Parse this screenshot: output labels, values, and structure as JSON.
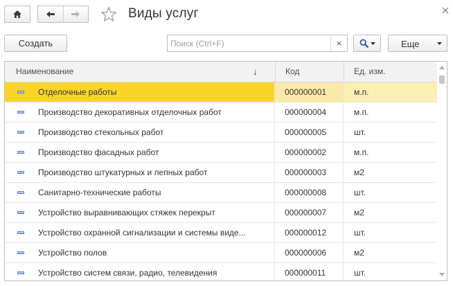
{
  "window": {
    "title": "Виды услуг",
    "icons": {
      "home": "home-icon",
      "back": "arrow-left-icon",
      "forward": "arrow-right-icon",
      "favorite": "star-icon",
      "close": "close-icon"
    }
  },
  "toolbar": {
    "create_label": "Создать",
    "search_placeholder": "Поиск (Ctrl+F)",
    "search_value": "",
    "clear_label": "×",
    "more_label": "Еще"
  },
  "table": {
    "columns": {
      "name": "Наименование",
      "code": "Код",
      "unit": "Ед. изм."
    },
    "sort_indicator": "↓",
    "selected_index": 0,
    "rows": [
      {
        "name": "Отделочные работы",
        "code": "000000001",
        "unit": "м.п."
      },
      {
        "name": "Производство декоративных отделочных работ",
        "code": "000000004",
        "unit": "м.п."
      },
      {
        "name": "Производство стекольных работ",
        "code": "000000005",
        "unit": "шт."
      },
      {
        "name": "Производство фасадных работ",
        "code": "000000002",
        "unit": "м.п."
      },
      {
        "name": "Производство штукатурных и лепных работ",
        "code": "000000003",
        "unit": "м2"
      },
      {
        "name": "Санитарно-технические работы",
        "code": "000000008",
        "unit": "шт."
      },
      {
        "name": "Устройство выравнивающих стяжек перекрыт",
        "code": "000000007",
        "unit": "м2"
      },
      {
        "name": "Устройство охранной сигнализации и системы виде...",
        "code": "000000012",
        "unit": "шт."
      },
      {
        "name": "Устройство полов",
        "code": "000000006",
        "unit": "м2"
      },
      {
        "name": "Устройство систем связи, радио, телевидения",
        "code": "000000011",
        "unit": "шт."
      }
    ]
  },
  "colors": {
    "selection_main": "#f9d52a",
    "selection_secondary": "#fbe9a7",
    "item_icon": "#5b7fb6"
  }
}
